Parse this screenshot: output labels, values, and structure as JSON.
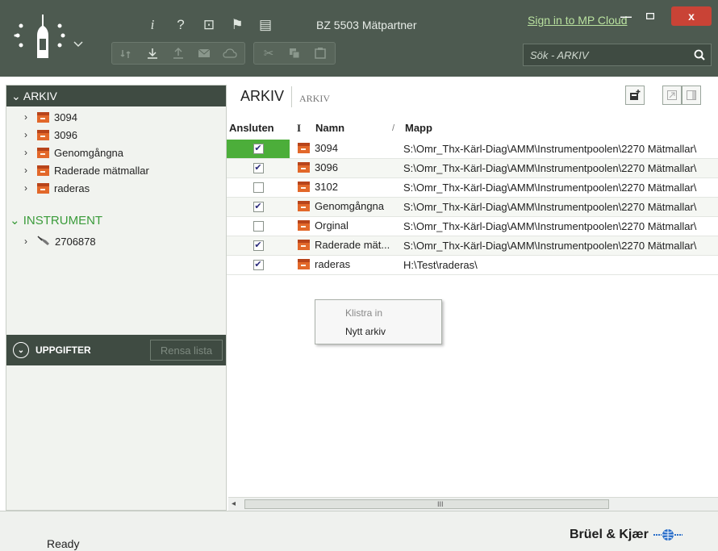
{
  "app": {
    "title": "BZ 5503 Mätpartner",
    "signin": "Sign in to MP Cloud"
  },
  "window": {
    "minimize": "—",
    "maximize": "□",
    "close": "x"
  },
  "toolbar": {
    "row1": [
      "info-icon",
      "help-icon",
      "calculator-icon",
      "flag-icon",
      "notebook-icon"
    ],
    "row1_glyphs": [
      "i",
      "?",
      "⊡",
      "⚑",
      "▤"
    ]
  },
  "search": {
    "placeholder": "Sök - ARKIV",
    "icon": "search-icon"
  },
  "sidebar": {
    "arkiv_title": "ARKIV",
    "arkiv_items": [
      {
        "label": "3094"
      },
      {
        "label": "3096"
      },
      {
        "label": "Genomgångna"
      },
      {
        "label": "Raderade mätmallar"
      },
      {
        "label": "raderas"
      }
    ],
    "instrument_title": "INSTRUMENT",
    "instrument_items": [
      {
        "label": "2706878"
      }
    ],
    "uppgifter": "UPPGIFTER",
    "rensa": "Rensa lista"
  },
  "main": {
    "tab": "ARKIV",
    "breadcrumb": "ARKIV",
    "columns": {
      "connected": "Ansluten",
      "i": "I",
      "name": "Namn",
      "sort": "/",
      "folder": "Mapp"
    },
    "rows": [
      {
        "checked": true,
        "name": "3094",
        "path": "S:\\Omr_Thx-Kärl-Diag\\AMM\\Instrumentpoolen\\2270 Mätmallar\\"
      },
      {
        "checked": true,
        "name": "3096",
        "path": "S:\\Omr_Thx-Kärl-Diag\\AMM\\Instrumentpoolen\\2270 Mätmallar\\"
      },
      {
        "checked": false,
        "name": "3102",
        "path": "S:\\Omr_Thx-Kärl-Diag\\AMM\\Instrumentpoolen\\2270 Mätmallar\\"
      },
      {
        "checked": true,
        "name": "Genomgångna",
        "path": "S:\\Omr_Thx-Kärl-Diag\\AMM\\Instrumentpoolen\\2270 Mätmallar\\"
      },
      {
        "checked": false,
        "name": "Orginal",
        "path": "S:\\Omr_Thx-Kärl-Diag\\AMM\\Instrumentpoolen\\2270 Mätmallar\\"
      },
      {
        "checked": true,
        "name": "Raderade mät...",
        "path": "S:\\Omr_Thx-Kärl-Diag\\AMM\\Instrumentpoolen\\2270 Mätmallar\\"
      },
      {
        "checked": true,
        "name": "raderas",
        "path": "H:\\Test\\raderas\\"
      }
    ]
  },
  "context_menu": {
    "paste": "Klistra in",
    "new_archive": "Nytt arkiv"
  },
  "scrollbar": {
    "grip": "III"
  },
  "status": {
    "text": "Ready",
    "brand": "Brüel & Kjær"
  },
  "colors": {
    "title_bar": "#4d5a50",
    "accent_green": "#4cae3a",
    "archive_orange": "#e2682a",
    "link_green": "#b9e19f"
  }
}
